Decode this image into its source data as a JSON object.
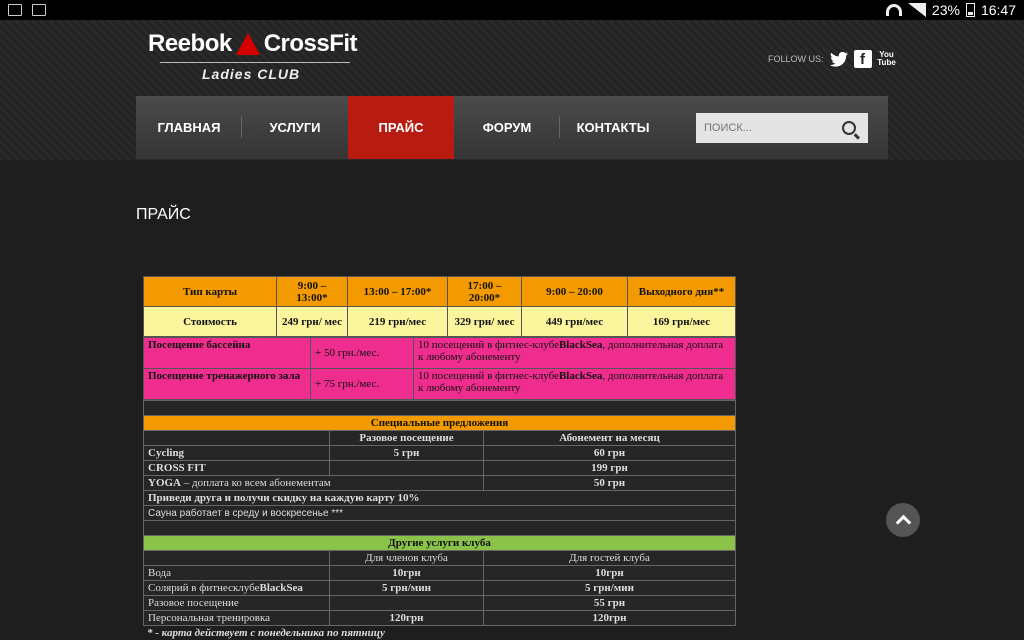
{
  "status_bar": {
    "battery": "23%",
    "time": "16:47"
  },
  "logo": {
    "brand_left": "Reebok",
    "brand_right": "CrossFit",
    "sub": "Ladies CLUB"
  },
  "follow": {
    "label": "FOLLOW US:",
    "icons": [
      "twitter-icon",
      "facebook-icon",
      "youtube-icon"
    ],
    "youtube_text_top": "You",
    "youtube_text_bottom": "Tube",
    "facebook_text": "f"
  },
  "nav": {
    "items": [
      {
        "label": "ГЛАВНАЯ"
      },
      {
        "label": "УСЛУГИ"
      },
      {
        "label": "ПРАЙС",
        "active": true
      },
      {
        "label": "ФОРУМ"
      },
      {
        "label": "КОНТАКТЫ"
      }
    ],
    "search_placeholder": "ПОИСК..."
  },
  "page_title": "ПРАЙС",
  "colors": {
    "active_nav": "#b81c10",
    "orange": "#f39a00",
    "yellow": "#fbf59d",
    "pink": "#ee2d8e",
    "green": "#8bc34a"
  },
  "card_table": {
    "headers": [
      "Тип карты",
      "9:00 – 13:00*",
      "13:00 – 17:00*",
      "17:00 – 20:00*",
      "9:00 – 20:00",
      "Выходного дня**"
    ],
    "prices": [
      "Стоимость",
      "249 грн/ мес",
      "219 грн/мес",
      "329 грн/ мес",
      "449 грн/мес",
      "169 грн/мес"
    ],
    "extras": [
      {
        "name": "Посещение бассейна",
        "price": "+ 50 грн./мес.",
        "note_pre": "10 посещений в фитнес-клубе",
        "note_bold": "BlackSea",
        "note_post": ", дополнительная доплата к любому абонементу"
      },
      {
        "name": "Посещение тренажерного зала",
        "price": "+ 75 грн./мес.",
        "note_pre": "10 посещений в фитнес-клубе",
        "note_bold": "BlackSea",
        "note_post": ", дополнительная доплата к любому абонементу"
      }
    ]
  },
  "special": {
    "title": "Специальные предложения",
    "col1": "Разовое посещение",
    "col2": "Абонемент на месяц",
    "rows": [
      {
        "name": "Cycling",
        "single": "5 грн",
        "month": "60 грн"
      },
      {
        "name": "CROSS FIT",
        "single": "",
        "month": "199 грн"
      },
      {
        "name_bold": "YOGA",
        "name_rest": " – доплата ко всем абонементам",
        "single": "",
        "month": "50 грн"
      }
    ],
    "promo": "Приведи друга и получи скидку на каждую карту 10%",
    "sauna": "Сауна работает в среду и воскресенье ***"
  },
  "other": {
    "title": "Другие услуги клуба",
    "col1": "Для членов клуба",
    "col2": "Для гостей клуба",
    "rows": [
      {
        "name": "Вода",
        "members": "10грн",
        "guests": "10грн"
      },
      {
        "name_pre": "Солярий в фитнесклубе",
        "name_bold": "BlackSea",
        "members": "5 грн/мин",
        "guests": "5 грн/мин"
      },
      {
        "name": "Разовое посещение",
        "members": "",
        "guests": "55 грн"
      },
      {
        "name": "Персональная тренировка",
        "members": "120грн",
        "guests": "120грн"
      }
    ]
  },
  "footnote": "* - карта действует с понедельника по пятницу"
}
